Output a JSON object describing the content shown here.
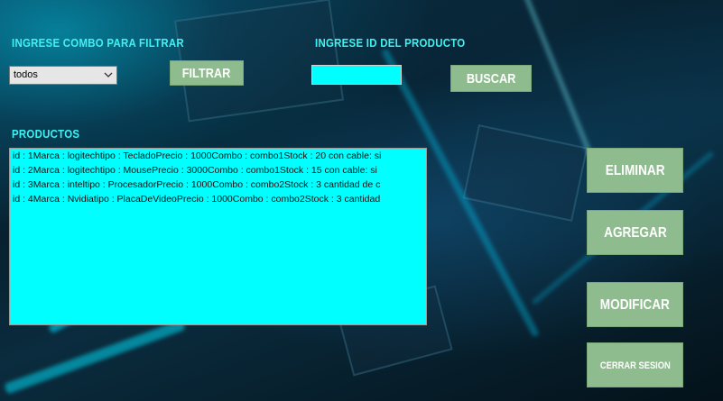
{
  "filter": {
    "label": "INGRESE COMBO PARA FILTRAR",
    "selected": "todos",
    "button": "FILTRAR"
  },
  "search": {
    "label": "INGRESE ID DEL PRODUCTO",
    "value": "",
    "button": "BUSCAR"
  },
  "products": {
    "label": "PRODUCTOS",
    "items": [
      "id : 1Marca : logitechtipo : TecladoPrecio : 1000Combo : combo1Stock : 20 con cable: si",
      "id : 2Marca : logitechtipo : MousePrecio : 3000Combo : combo1Stock : 15 con cable: si",
      "id : 3Marca : inteltipo : ProcesadorPrecio : 1000Combo : combo2Stock : 3 cantidad de c",
      "id : 4Marca : Nvidiatipo : PlacaDeVideoPrecio : 1000Combo : combo2Stock : 3 cantidad"
    ]
  },
  "actions": {
    "delete": "ELIMINAR",
    "add": "AGREGAR",
    "modify": "MODIFICAR",
    "logout": "CERRAR SESION"
  },
  "colors": {
    "label_text": "#3ff2f2",
    "button_bg": "#8fbc8f",
    "input_bg": "#00ffff"
  }
}
